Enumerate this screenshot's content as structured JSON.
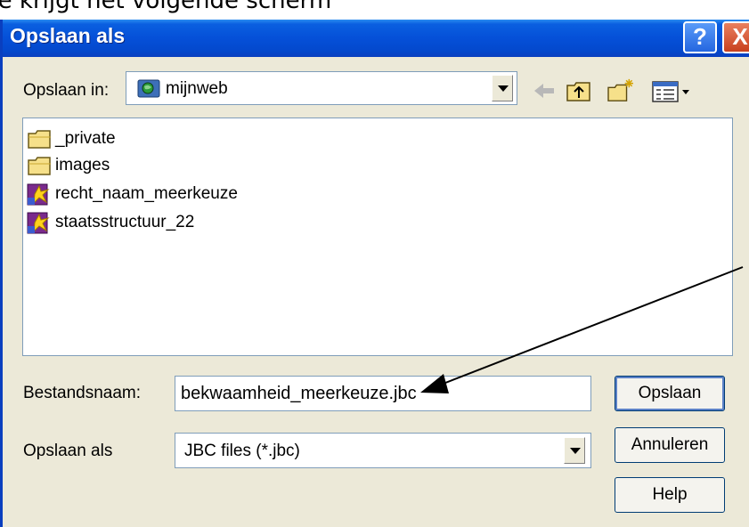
{
  "caption": "Je krijgt het volgende scherm",
  "dialog": {
    "title": "Opslaan als",
    "help_button": "?",
    "close_button": "X"
  },
  "lookin": {
    "label": "Opslaan in:",
    "value": "mijnweb"
  },
  "files": [
    {
      "name": "_private",
      "type": "folder"
    },
    {
      "name": "images",
      "type": "folder"
    },
    {
      "name": "recht_naam_meerkeuze",
      "type": "jbc"
    },
    {
      "name": "staatsstructuur_22",
      "type": "jbc"
    }
  ],
  "filename": {
    "label": "Bestandsnaam:",
    "value": "bekwaamheid_meerkeuze.jbc"
  },
  "filetype": {
    "label": "Opslaan als",
    "value": "JBC files (*.jbc)"
  },
  "buttons": {
    "save": "Opslaan",
    "cancel": "Annuleren",
    "help": "Help"
  }
}
